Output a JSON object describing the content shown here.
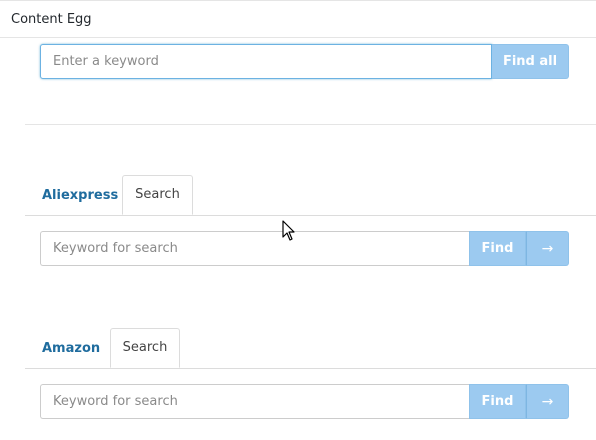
{
  "header": {
    "title": "Content Egg"
  },
  "keyword_search": {
    "placeholder": "Enter a keyword",
    "value": "",
    "button_label": "Find all"
  },
  "modules": [
    {
      "name": "Aliexpress",
      "tab_label": "Search",
      "search_placeholder": "Keyword for search",
      "find_label": "Find",
      "arrow_label": "→"
    },
    {
      "name": "Amazon",
      "tab_label": "Search",
      "search_placeholder": "Keyword for search",
      "find_label": "Find",
      "arrow_label": "→"
    }
  ],
  "colors": {
    "accent_button": "#9ccaf0",
    "module_link": "#1f6c9e",
    "focus_border": "#6cb2e2"
  }
}
